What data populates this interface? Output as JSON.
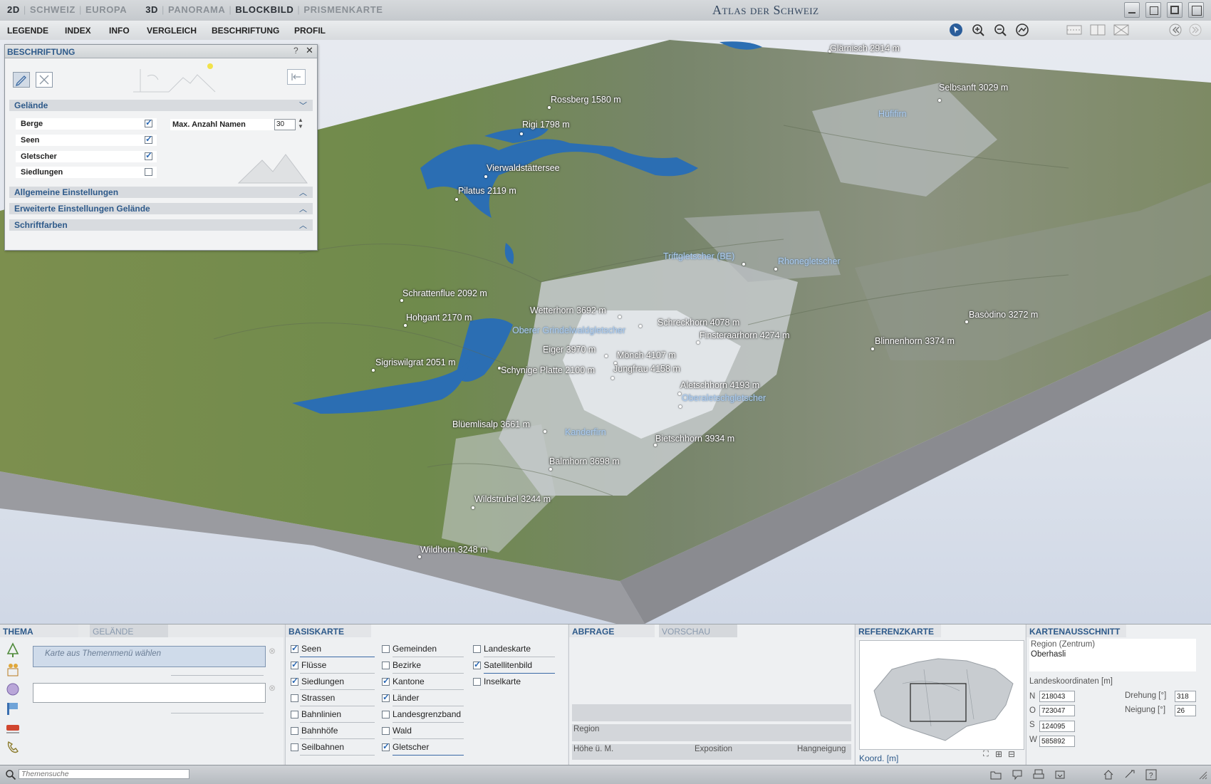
{
  "top": {
    "modes_2d": [
      "2D",
      "SCHWEIZ",
      "EUROPA"
    ],
    "modes_3d": [
      "3D",
      "PANORAMA",
      "BLOCKBILD",
      "PRISMENKARTE"
    ],
    "active_mode": "BLOCKBILD",
    "title": "Atlas der Schweiz"
  },
  "menu": [
    "LEGENDE",
    "INDEX",
    "INFO",
    "VERGLEICH",
    "BESCHRIFTUNG",
    "PROFIL"
  ],
  "panel": {
    "title": "BESCHRIFTUNG",
    "help": "?",
    "close": "✕",
    "section_gelaende": "Gelände",
    "items": [
      {
        "label": "Berge",
        "checked": true
      },
      {
        "label": "Seen",
        "checked": true
      },
      {
        "label": "Gletscher",
        "checked": true
      },
      {
        "label": "Siedlungen",
        "checked": false
      }
    ],
    "max_label": "Max. Anzahl Namen",
    "max_value": "30",
    "sections": [
      "Allgemeine Einstellungen",
      "Erweiterte Einstellungen Gelände",
      "Schriftfarben"
    ]
  },
  "labels": {
    "glaernisch": "Glärnisch   2914 m",
    "selbsanft": "Selbsanft   3029 m",
    "hueffirn": "Hüfifirn",
    "rossberg": "Rossberg   1580 m",
    "rigi": "Rigi   1798 m",
    "vierwald": "Vierwaldstättersee",
    "pilatus": "Pilatus   2119 m",
    "trift": "Triftgletscher (BE)",
    "rhone": "Rhonegletscher",
    "schratten": "Schrattenflue   2092 m",
    "hohgant": "Hohgant   2170 m",
    "wetterhorn": "Wetterhorn   3692 m",
    "grindel": "Oberer Grindelwaldgletscher",
    "schreck": "Schreckhorn   4078 m",
    "finster": "Finsteraarhorn   4274 m",
    "basodino": "Basòdino   3272 m",
    "blinnen": "Blinnenhorn   3374 m",
    "eiger": "Eiger   3970 m",
    "moench": "Mönch   4107 m",
    "sigris": "Sigriswilgrat   2051 m",
    "schynige": "Schynige Platte   2100 m",
    "jungfrau": "Jungfrau   4158 m",
    "aletsch": "Aletschhorn   4193 m",
    "oberaletsch": "Oberaletschgletscher",
    "bluemlis": "Blüemlisalp   3661 m",
    "kanderfirn": "Kanderfirn",
    "bietsch": "Bietschhorn   3934 m",
    "balmhorn": "Balmhorn   3698 m",
    "wildstrubel": "Wildstrubel   3244 m",
    "wildhorn": "Wildhorn   3248 m"
  },
  "bottom": {
    "thema_tab": "THEMA",
    "gelaende_tab": "GELÄNDE",
    "thema_placeholder": "Karte aus Themenmenü wählen",
    "basis_title": "BASISKARTE",
    "basis_col1": [
      {
        "label": "Seen",
        "checked": true
      },
      {
        "label": "Flüsse",
        "checked": true
      },
      {
        "label": "Siedlungen",
        "checked": true
      },
      {
        "label": "Strassen",
        "checked": false
      },
      {
        "label": "Bahnlinien",
        "checked": false
      },
      {
        "label": "Bahnhöfe",
        "checked": false
      },
      {
        "label": "Seilbahnen",
        "checked": false
      }
    ],
    "basis_col2": [
      {
        "label": "Gemeinden",
        "checked": false
      },
      {
        "label": "Bezirke",
        "checked": false
      },
      {
        "label": "Kantone",
        "checked": true
      },
      {
        "label": "Länder",
        "checked": true
      },
      {
        "label": "Landesgrenzband",
        "checked": false
      },
      {
        "label": "Wald",
        "checked": false
      },
      {
        "label": "Gletscher",
        "checked": true
      }
    ],
    "basis_col3": [
      {
        "label": "Landeskarte",
        "checked": false
      },
      {
        "label": "Satellitenbild",
        "checked": true
      },
      {
        "label": "Inselkarte",
        "checked": false
      }
    ],
    "abfrage_tab": "ABFRAGE",
    "vorschau_tab": "VORSCHAU",
    "region": "Region",
    "hoehe": "Höhe ü. M.",
    "exposition": "Exposition",
    "hangneigung": "Hangneigung",
    "ref_title": "REFERENZKARTE",
    "koord": "Koord. [m]",
    "ausschnitt_title": "KARTENAUSSCHNITT",
    "region_label": "Region (Zentrum)",
    "region_value": "Oberhasli",
    "landeskoord": "Landeskoordinaten [m]",
    "N": "218043",
    "O": "723047",
    "S": "124095",
    "W": "585892",
    "drehung_label": "Drehung [°]",
    "drehung": "318",
    "neigung_label": "Neigung [°]",
    "neigung": "26"
  },
  "status": {
    "search_placeholder": "Themensuche"
  }
}
